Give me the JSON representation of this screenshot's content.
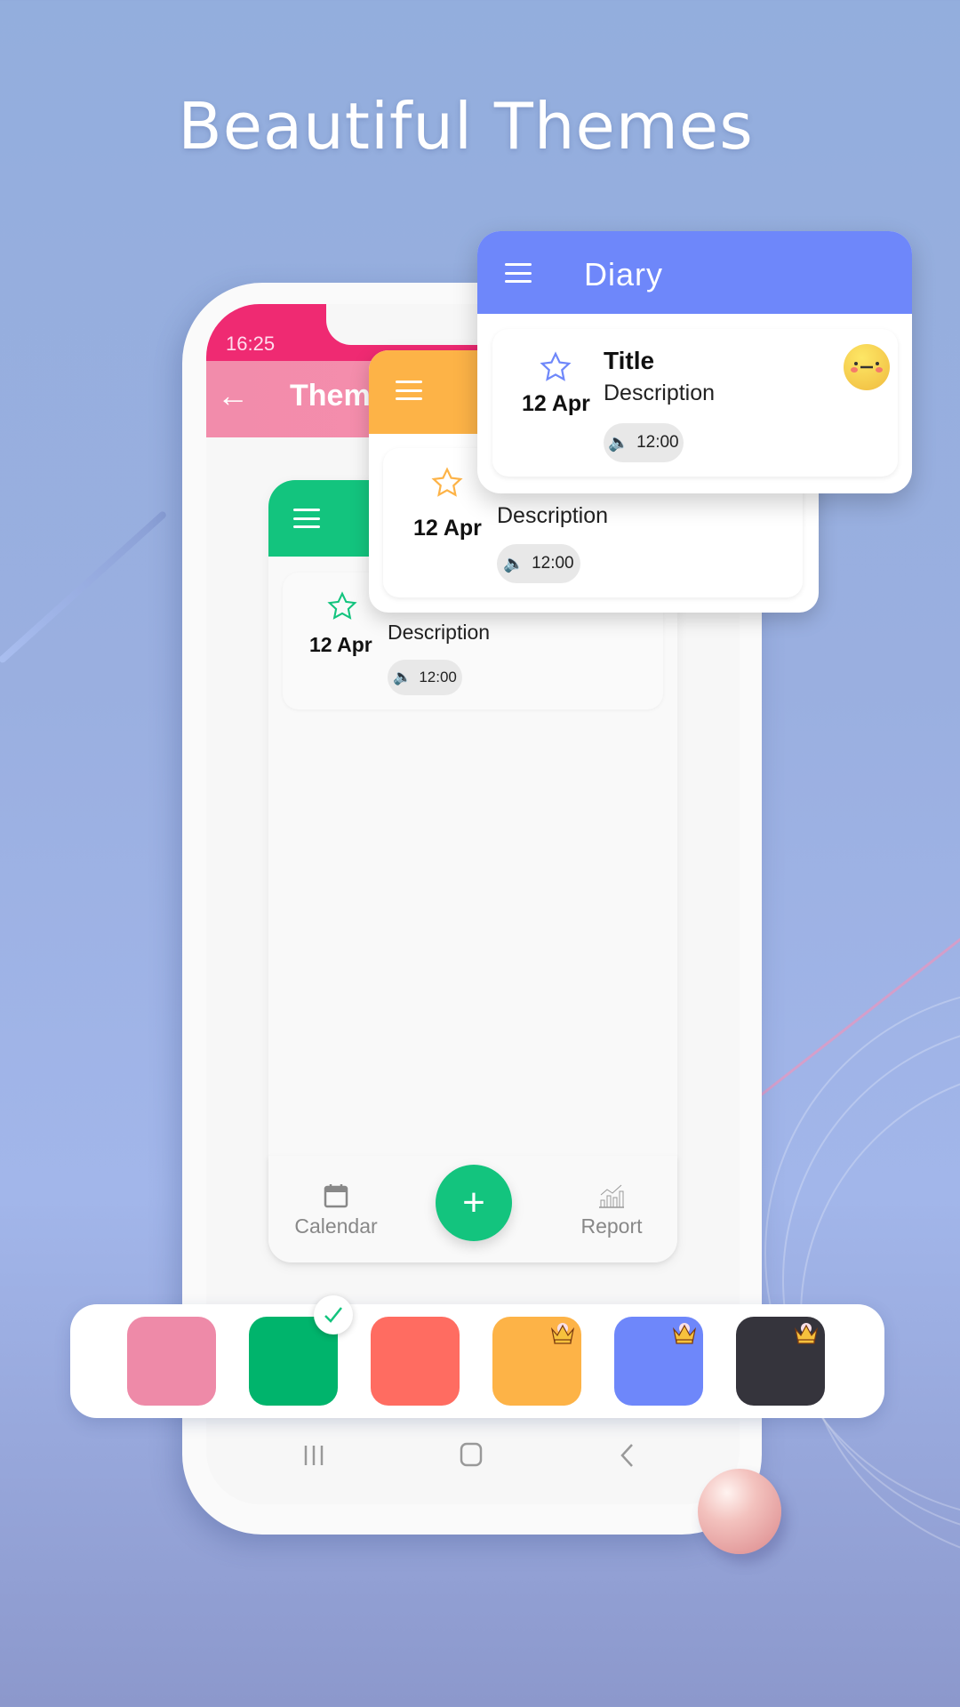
{
  "headline": "Beautiful Themes",
  "status_bar": {
    "time": "16:25"
  },
  "themes_screen": {
    "title": "Them",
    "back_icon": "arrow-left-icon"
  },
  "diary_card": {
    "title": "Title",
    "description": "Description",
    "date": "12 Apr",
    "reminder_time": "12:00",
    "star_icon": "star-outline-icon",
    "sound_icon": "speaker-icon",
    "mood_icon": "neutral-face-icon"
  },
  "blue_app": {
    "title": "Diary",
    "accent": "#6e87fa"
  },
  "orange_app": {
    "accent": "#fdb347"
  },
  "green_app": {
    "accent": "#13c47e"
  },
  "bottom_nav": {
    "calendar_label": "Calendar",
    "report_label": "Report",
    "fab_label": "+"
  },
  "theme_picker": {
    "selected_index": 1,
    "swatches": [
      {
        "name": "pink",
        "color": "#ee8aa8",
        "premium": false
      },
      {
        "name": "green",
        "color": "#00b46c",
        "premium": false
      },
      {
        "name": "coral",
        "color": "#ff6c61",
        "premium": false
      },
      {
        "name": "orange",
        "color": "#fdb347",
        "premium": true
      },
      {
        "name": "blue",
        "color": "#6e87fa",
        "premium": true
      },
      {
        "name": "dark",
        "color": "#35343c",
        "premium": true
      }
    ]
  },
  "system_nav": {
    "recents": "|||",
    "home": "○",
    "back": "‹"
  }
}
